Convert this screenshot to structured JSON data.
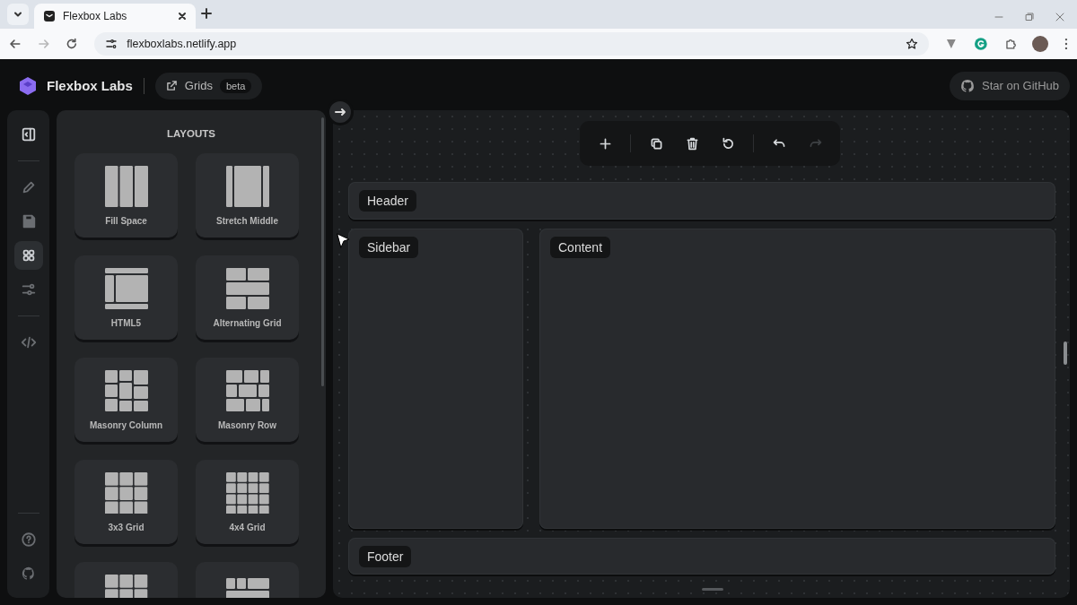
{
  "browser": {
    "tab_title": "Flexbox Labs",
    "url": "flexboxlabs.netlify.app"
  },
  "header": {
    "brand": "Flexbox Labs",
    "link": {
      "label": "Grids",
      "badge": "beta"
    },
    "github_button": "Star on GitHub"
  },
  "rail": [
    {
      "kind": "collapse",
      "selected": false
    },
    {
      "kind": "divider"
    },
    {
      "kind": "edit",
      "selected": false
    },
    {
      "kind": "save",
      "selected": false
    },
    {
      "kind": "layouts",
      "selected": true
    },
    {
      "kind": "settings",
      "selected": false
    },
    {
      "kind": "divider"
    },
    {
      "kind": "code",
      "selected": false
    },
    {
      "kind": "spacer"
    },
    {
      "kind": "divider"
    },
    {
      "kind": "help",
      "selected": false
    },
    {
      "kind": "github",
      "selected": false
    }
  ],
  "panel": {
    "title": "LAYOUTS",
    "layouts": [
      {
        "kind": "fill-space",
        "label": "Fill Space"
      },
      {
        "kind": "stretch-middle",
        "label": "Stretch Middle"
      },
      {
        "kind": "html5",
        "label": "HTML5"
      },
      {
        "kind": "alternating",
        "label": "Alternating Grid"
      },
      {
        "kind": "masonry-column",
        "label": "Masonry Column"
      },
      {
        "kind": "masonry-row",
        "label": "Masonry Row"
      },
      {
        "kind": "grid3",
        "label": "3x3 Grid"
      },
      {
        "kind": "grid4",
        "label": "4x4 Grid"
      },
      {
        "kind": "grid3"
      },
      {
        "kind": "mixed"
      }
    ]
  },
  "toolbar": [
    {
      "kind": "add",
      "disabled": false
    },
    {
      "kind": "divider"
    },
    {
      "kind": "duplicate",
      "disabled": false
    },
    {
      "kind": "delete",
      "disabled": false
    },
    {
      "kind": "reset",
      "disabled": false
    },
    {
      "kind": "divider"
    },
    {
      "kind": "undo",
      "disabled": false
    },
    {
      "kind": "redo",
      "disabled": true
    }
  ],
  "canvas": {
    "areas": [
      {
        "kind": "header",
        "label": "Header"
      },
      {
        "kind": "sidebar",
        "label": "Sidebar"
      },
      {
        "kind": "content",
        "label": "Content"
      },
      {
        "kind": "footer",
        "label": "Footer"
      }
    ]
  }
}
